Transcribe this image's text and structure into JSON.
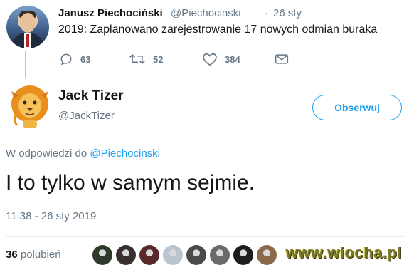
{
  "parent_tweet": {
    "author_name": "Janusz Piechociński",
    "handle": "@Piechocinski",
    "separator": "·",
    "date": "26 sty",
    "text": "2019: Zaplanowano zarejestrowanie 17 nowych odmian buraka",
    "actions": {
      "reply_count": "63",
      "retweet_count": "52",
      "like_count": "384"
    },
    "icons": [
      "reply-icon",
      "retweet-icon",
      "like-icon",
      "message-icon"
    ]
  },
  "reply_tweet": {
    "author_name": "Jack Tizer",
    "handle": "@JackTizer",
    "follow_label": "Obserwuj",
    "reply_to_prefix": "W odpowiedzi do",
    "reply_to_handle": "@Piechocinski",
    "text": "I to tylko w samym sejmie.",
    "timestamp": "11:38 - 26 sty 2019",
    "likes_count": "36",
    "likes_label": "polubień"
  },
  "liker_avatars": [
    "#2e3a2a",
    "#3a3030",
    "#5a2a2a",
    "#b8c4cf",
    "#4a4a4a",
    "#6a6a6a",
    "#1e1e1e",
    "#8a6a4a"
  ],
  "watermark": "www.wiocha.pl",
  "colors": {
    "accent": "#1da1f2",
    "muted": "#657786",
    "text": "#14171a",
    "thread": "#9fd0d6"
  }
}
